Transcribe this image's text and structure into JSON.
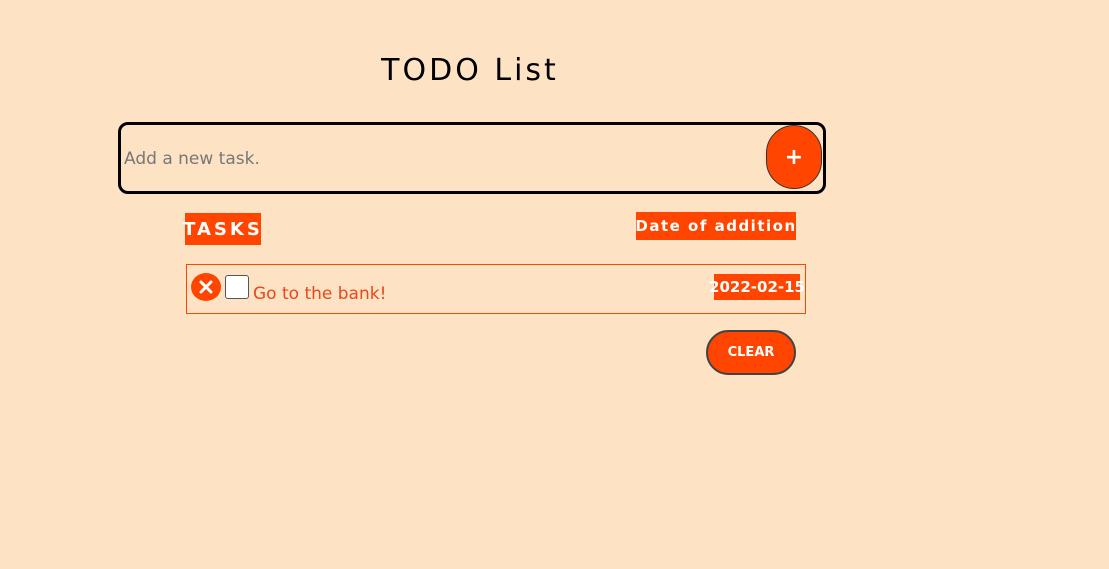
{
  "app": {
    "title": "TODO List"
  },
  "new_task": {
    "placeholder": "Add a new task.",
    "value": "",
    "add_label": "+"
  },
  "headers": {
    "tasks": "TASKS",
    "date": "Date of addition"
  },
  "tasks": [
    {
      "text": "Go to the bank!",
      "date": "2022-02-15",
      "completed": false,
      "delete_icon": "close-icon"
    }
  ],
  "actions": {
    "clear_label": "CLEAR"
  },
  "colors": {
    "background": "#FEE2C4",
    "accent": "#FF4500",
    "task_text": "#E8481C"
  }
}
